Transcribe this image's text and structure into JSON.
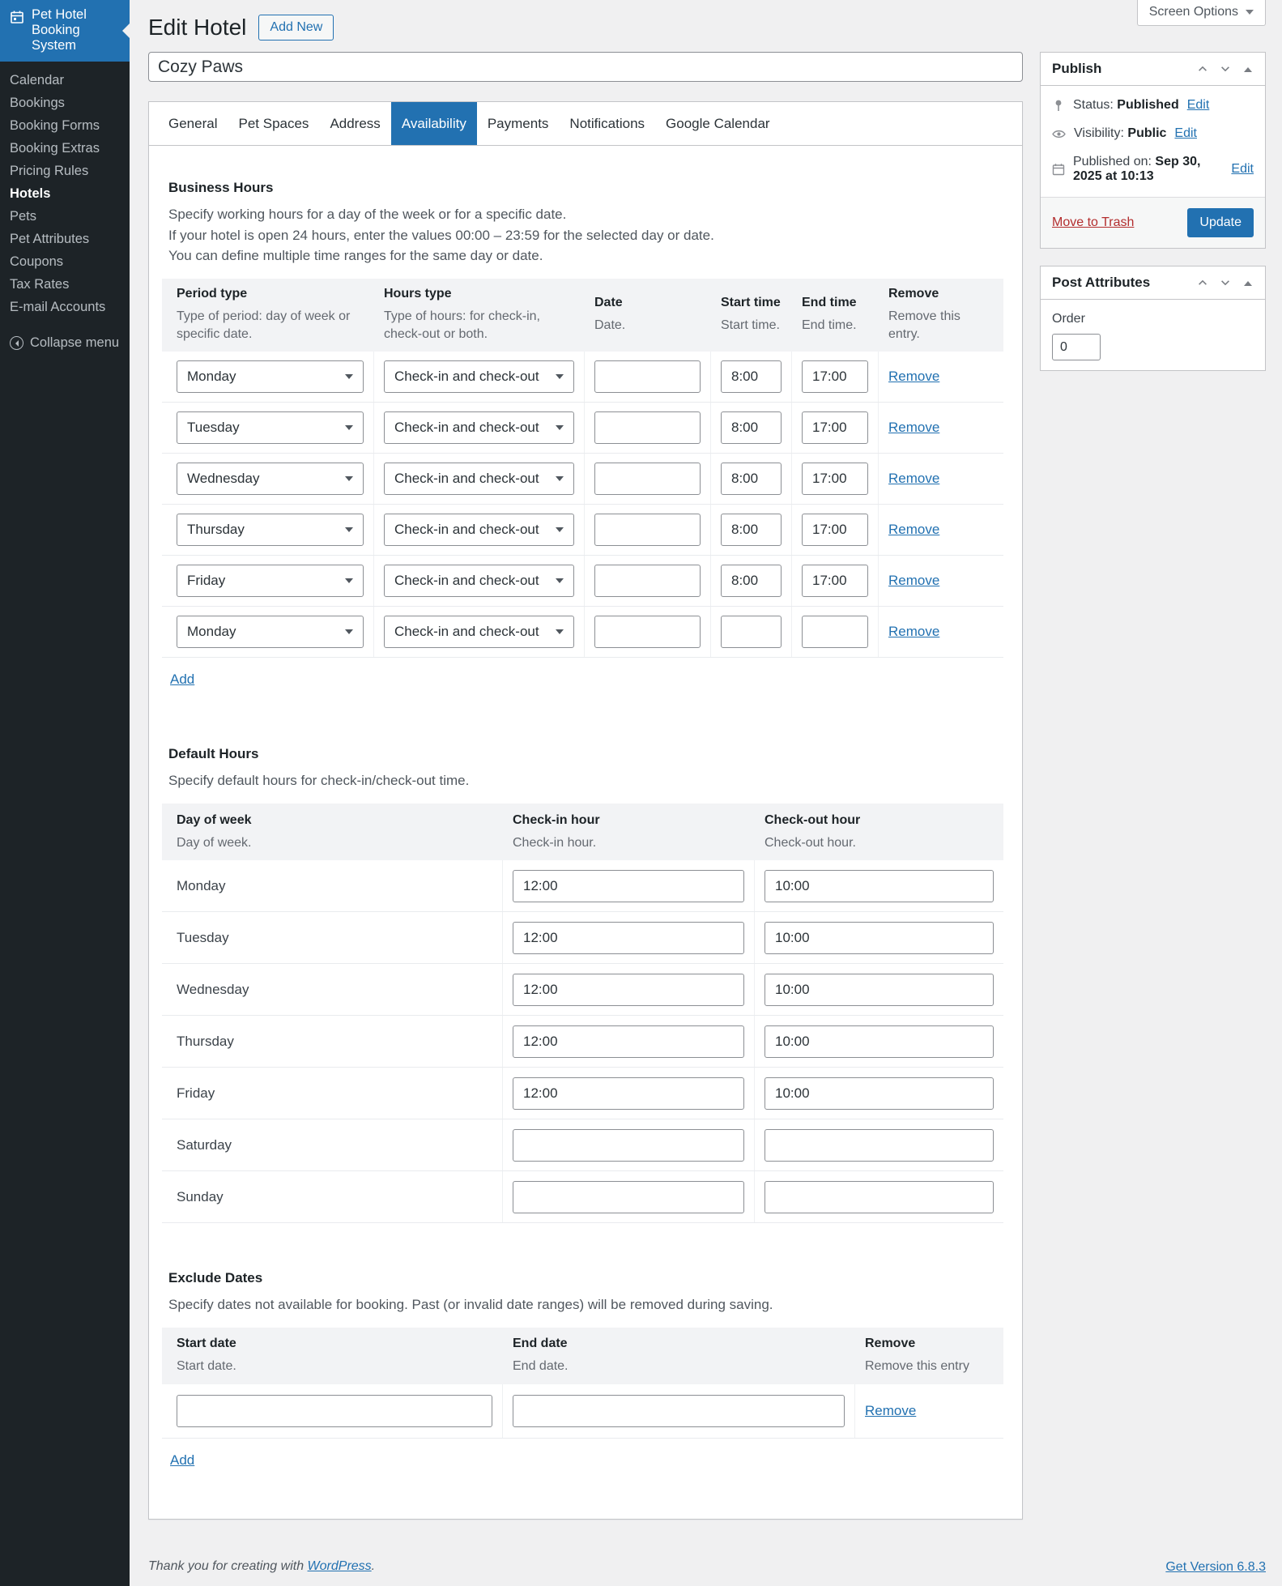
{
  "colors": {
    "accent": "#2271b1",
    "sidebar_bg": "#1d2327",
    "danger": "#b32d2e",
    "content_bg": "#f0f0f1"
  },
  "screen_options": {
    "label": "Screen Options"
  },
  "sidebar": {
    "brand": {
      "line1": "Pet Hotel",
      "line2": "Booking System"
    },
    "items": [
      {
        "label": "Calendar",
        "active": false
      },
      {
        "label": "Bookings",
        "active": false
      },
      {
        "label": "Booking Forms",
        "active": false
      },
      {
        "label": "Booking Extras",
        "active": false
      },
      {
        "label": "Pricing Rules",
        "active": false
      },
      {
        "label": "Hotels",
        "active": true
      },
      {
        "label": "Pets",
        "active": false
      },
      {
        "label": "Pet Attributes",
        "active": false
      },
      {
        "label": "Coupons",
        "active": false
      },
      {
        "label": "Tax Rates",
        "active": false
      },
      {
        "label": "E-mail Accounts",
        "active": false
      }
    ],
    "collapse_label": "Collapse menu"
  },
  "header": {
    "title": "Edit Hotel",
    "add_new_label": "Add New"
  },
  "title_field": {
    "value": "Cozy Paws"
  },
  "tabs": [
    {
      "label": "General"
    },
    {
      "label": "Pet Spaces"
    },
    {
      "label": "Address"
    },
    {
      "label": "Availability",
      "active": true
    },
    {
      "label": "Payments"
    },
    {
      "label": "Notifications"
    },
    {
      "label": "Google Calendar"
    }
  ],
  "business_hours": {
    "heading": "Business Hours",
    "desc1": "Specify working hours for a day of the week or for a specific date.",
    "desc2": "If your hotel is open 24 hours, enter the values 00:00 – 23:59 for the selected day or date.",
    "desc3": "You can define multiple time ranges for the same day or date.",
    "columns": [
      {
        "label": "Period type",
        "desc": "Type of period: day of week or specific date."
      },
      {
        "label": "Hours type",
        "desc": "Type of hours: for check-in, check-out or both."
      },
      {
        "label": "Date",
        "desc": "Date."
      },
      {
        "label": "Start time",
        "desc": "Start time."
      },
      {
        "label": "End time",
        "desc": "End time."
      },
      {
        "label": "Remove",
        "desc": "Remove this entry."
      }
    ],
    "remove_label": "Remove",
    "add_label": "Add",
    "rows": [
      {
        "period": "Monday",
        "hours_type": "Check-in and check-out",
        "date": "",
        "start": "8:00",
        "end": "17:00"
      },
      {
        "period": "Tuesday",
        "hours_type": "Check-in and check-out",
        "date": "",
        "start": "8:00",
        "end": "17:00"
      },
      {
        "period": "Wednesday",
        "hours_type": "Check-in and check-out",
        "date": "",
        "start": "8:00",
        "end": "17:00"
      },
      {
        "period": "Thursday",
        "hours_type": "Check-in and check-out",
        "date": "",
        "start": "8:00",
        "end": "17:00"
      },
      {
        "period": "Friday",
        "hours_type": "Check-in and check-out",
        "date": "",
        "start": "8:00",
        "end": "17:00"
      },
      {
        "period": "Monday",
        "hours_type": "Check-in and check-out",
        "date": "",
        "start": "",
        "end": ""
      }
    ]
  },
  "default_hours": {
    "heading": "Default Hours",
    "desc": "Specify default hours for check-in/check-out time.",
    "columns": [
      {
        "label": "Day of week",
        "desc": "Day of week."
      },
      {
        "label": "Check-in hour",
        "desc": "Check-in hour."
      },
      {
        "label": "Check-out hour",
        "desc": "Check-out hour."
      }
    ],
    "rows": [
      {
        "day": "Monday",
        "checkin": "12:00",
        "checkout": "10:00"
      },
      {
        "day": "Tuesday",
        "checkin": "12:00",
        "checkout": "10:00"
      },
      {
        "day": "Wednesday",
        "checkin": "12:00",
        "checkout": "10:00"
      },
      {
        "day": "Thursday",
        "checkin": "12:00",
        "checkout": "10:00"
      },
      {
        "day": "Friday",
        "checkin": "12:00",
        "checkout": "10:00"
      },
      {
        "day": "Saturday",
        "checkin": "",
        "checkout": ""
      },
      {
        "day": "Sunday",
        "checkin": "",
        "checkout": ""
      }
    ]
  },
  "exclude_dates": {
    "heading": "Exclude Dates",
    "desc": "Specify dates not available for booking. Past (or invalid date ranges) will be removed during saving.",
    "columns": [
      {
        "label": "Start date",
        "desc": "Start date."
      },
      {
        "label": "End date",
        "desc": "End date."
      },
      {
        "label": "Remove",
        "desc": "Remove this entry"
      }
    ],
    "row": {
      "start": "",
      "end": ""
    },
    "remove_label": "Remove",
    "add_label": "Add"
  },
  "publish": {
    "title": "Publish",
    "status_label": "Status:",
    "status_value": "Published",
    "visibility_label": "Visibility:",
    "visibility_value": "Public",
    "published_label": "Published on:",
    "published_value": "Sep 30, 2025 at 10:13",
    "edit_label": "Edit",
    "move_to_trash": "Move to Trash",
    "update_label": "Update"
  },
  "post_attributes": {
    "title": "Post Attributes",
    "order_label": "Order",
    "order_value": "0"
  },
  "footer": {
    "thanks_prefix": "Thank you for creating with",
    "wordpress_link": "WordPress",
    "suffix": ".",
    "version_link": "Get Version 6.8.3"
  }
}
